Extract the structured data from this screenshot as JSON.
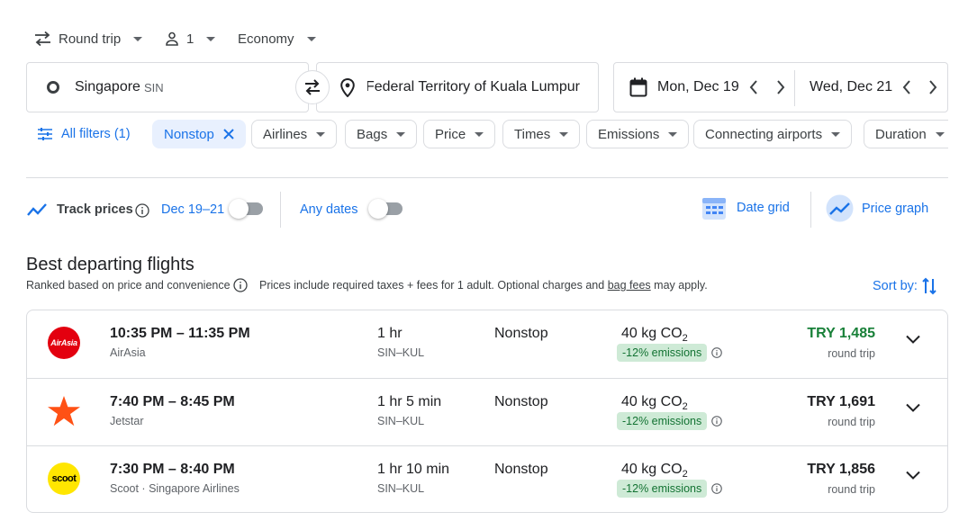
{
  "options": {
    "trip_type": "Round trip",
    "passengers": "1",
    "cabin": "Economy"
  },
  "search": {
    "origin_city": "Singapore",
    "origin_code": "SIN",
    "destination": "Federal Territory of Kuala Lumpur",
    "depart_date": "Mon, Dec 19",
    "return_date": "Wed, Dec 21"
  },
  "filters": {
    "all_filters": "All filters (1)",
    "chips": [
      "Nonstop",
      "Airlines",
      "Bags",
      "Price",
      "Times",
      "Emissions",
      "Connecting airports",
      "Duration"
    ]
  },
  "tools": {
    "track_prices": "Track prices",
    "track_dates": "Dec 19–21",
    "any_dates": "Any dates",
    "date_grid": "Date grid",
    "price_graph": "Price graph"
  },
  "section": {
    "title": "Best departing flights",
    "ranked_note": "Ranked based on price and convenience",
    "price_note_pre": "Prices include required taxes + fees for 1 adult. Optional charges and",
    "price_note_link": "bag fees",
    "price_note_post": "may apply.",
    "sort_label": "Sort by:"
  },
  "flights": [
    {
      "times": "10:35 PM – 11:35 PM",
      "airline": "AirAsia",
      "duration": "1 hr",
      "route": "SIN–KUL",
      "stops": "Nonstop",
      "co2": "40 kg CO",
      "emissions": "-12% emissions",
      "price": "TRY 1,485",
      "price_type": "round trip",
      "logo_text": "AirAsia",
      "logo_color": "#e3000f"
    },
    {
      "times": "7:40 PM – 8:45 PM",
      "airline": "Jetstar",
      "duration": "1 hr 5 min",
      "route": "SIN–KUL",
      "stops": "Nonstop",
      "co2": "40 kg CO",
      "emissions": "-12% emissions",
      "price": "TRY 1,691",
      "price_type": "round trip",
      "logo_color": "#ff5115"
    },
    {
      "times": "7:30 PM – 8:40 PM",
      "airline": "Scoot · Singapore Airlines",
      "duration": "1 hr 10 min",
      "route": "SIN–KUL",
      "stops": "Nonstop",
      "co2": "40 kg CO",
      "emissions": "-12% emissions",
      "price": "TRY 1,856",
      "price_type": "round trip",
      "logo_text": "scoot",
      "logo_color": "#ffe600"
    }
  ],
  "colors": {
    "accent": "#1a73e8",
    "best_price": "#188038",
    "emissions_bg": "#ceead6"
  }
}
